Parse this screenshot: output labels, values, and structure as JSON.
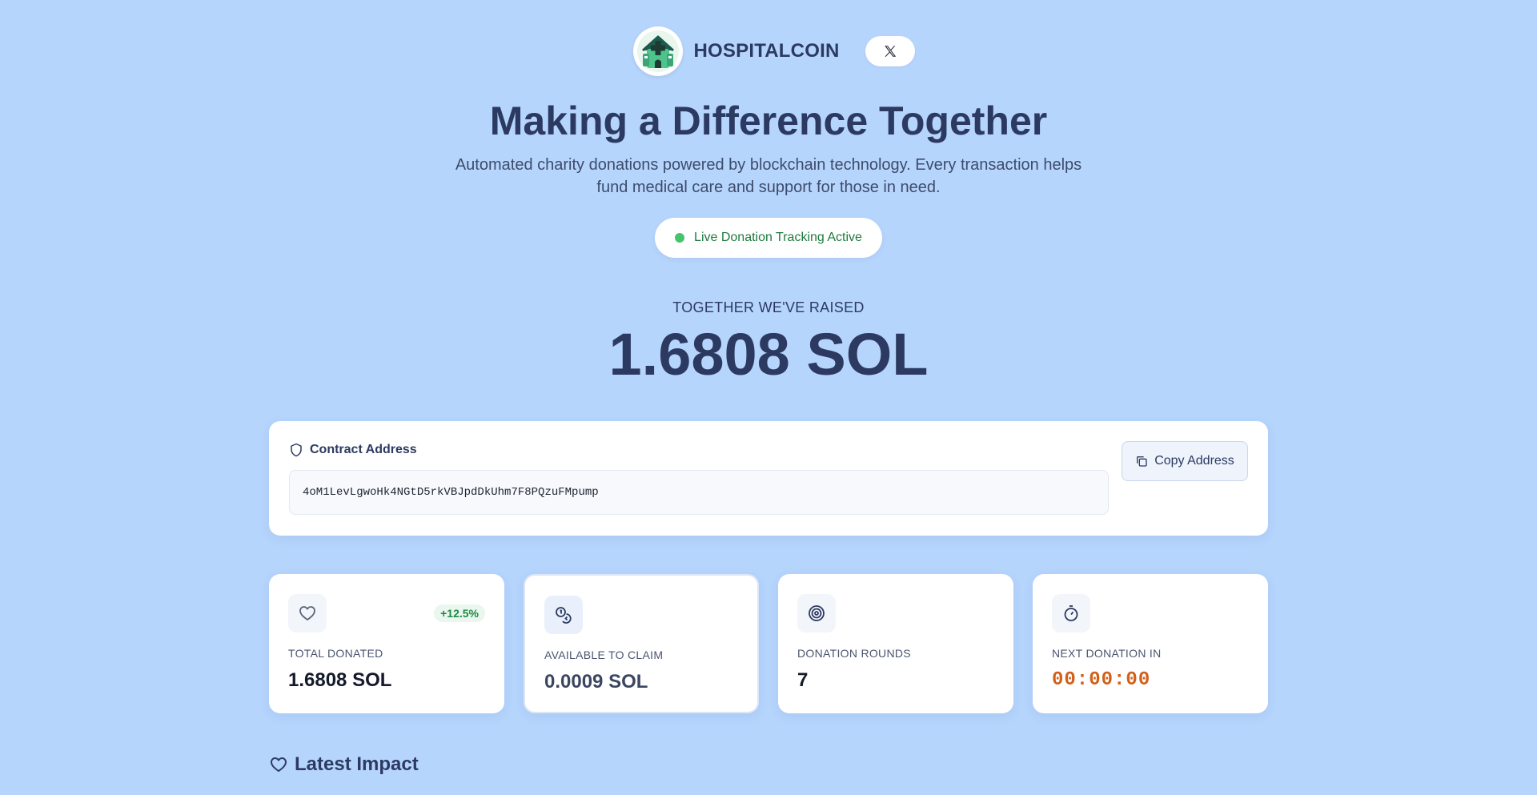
{
  "header": {
    "brand": "HOSPITALCOIN",
    "logo_icon": "hospital-house-icon",
    "social_icon": "x-logo-icon"
  },
  "hero": {
    "title": "Making a Difference Together",
    "subtitle": "Automated charity donations powered by blockchain technology. Every transaction helps fund medical care and support for those in need.",
    "live_status": "Live Donation Tracking Active"
  },
  "raised": {
    "label": "TOGETHER WE'VE RAISED",
    "amount": "1.6808 SOL"
  },
  "contract": {
    "heading": "Contract Address",
    "address": "4oM1LevLgwoHk4NGtD5rkVBJpdDkUhm7F8PQzuFMpump",
    "copy_label": "Copy Address",
    "shield_icon": "shield-icon",
    "copy_icon": "copy-icon"
  },
  "stats": [
    {
      "icon": "heart-icon",
      "label": "TOTAL DONATED",
      "value": "1.6808 SOL",
      "badge": "+12.5%"
    },
    {
      "icon": "coins-icon",
      "label": "AVAILABLE TO CLAIM",
      "value": "0.0009 SOL"
    },
    {
      "icon": "target-icon",
      "label": "DONATION ROUNDS",
      "value": "7"
    },
    {
      "icon": "timer-icon",
      "label": "NEXT DONATION IN",
      "value": "00:00:00"
    }
  ],
  "impact": {
    "heading": "Latest Impact"
  },
  "colors": {
    "background": "#b6d5fd",
    "primary_text": "#2c3a62",
    "live_green": "#45c46c",
    "badge_green": "#1f8a45",
    "timer_orange": "#d2601a"
  }
}
